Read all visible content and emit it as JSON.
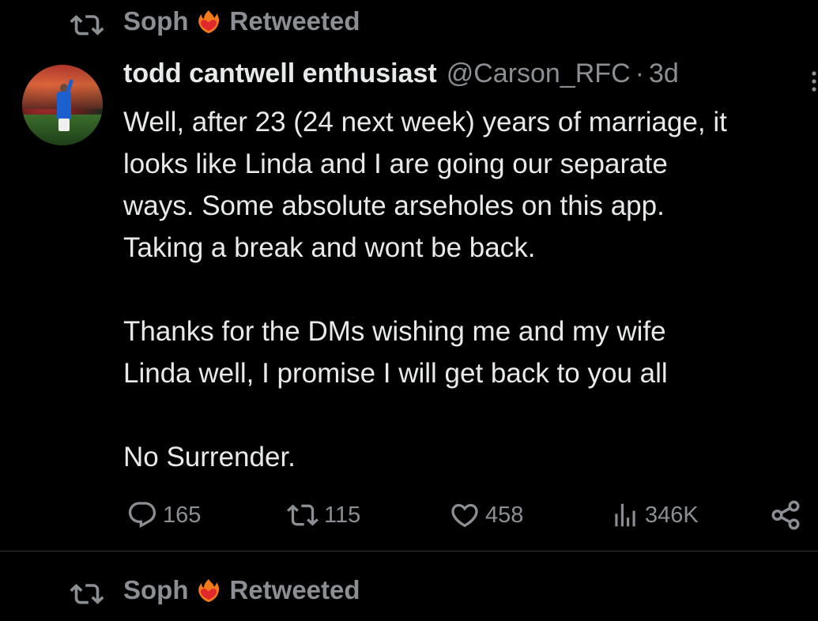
{
  "retweet_banner_top": {
    "user": "Soph",
    "label": "Retweeted",
    "emoji": "heart-on-fire"
  },
  "tweet": {
    "display_name": "todd cantwell enthusiast",
    "handle": "@Carson_RFC",
    "separator": "·",
    "time": "3d",
    "body_lines": [
      "Well, after 23 (24 next week) years of marriage, it",
      "looks like Linda and I are going our separate",
      "ways. Some absolute arseholes on this app.",
      "Taking a break and wont be back.",
      "",
      "Thanks for the DMs wishing me and my wife",
      "Linda well, I promise I will get back to you all",
      "",
      "No Surrender."
    ],
    "actions": {
      "replies": "165",
      "retweets": "115",
      "likes": "458",
      "views": "346K"
    }
  },
  "retweet_banner_bottom": {
    "user": "Soph",
    "label": "Retweeted",
    "emoji": "heart-on-fire"
  },
  "colors": {
    "background": "#000000",
    "text_primary": "#e7e9ea",
    "text_secondary": "#8b8f94",
    "divider": "#2f3336"
  }
}
